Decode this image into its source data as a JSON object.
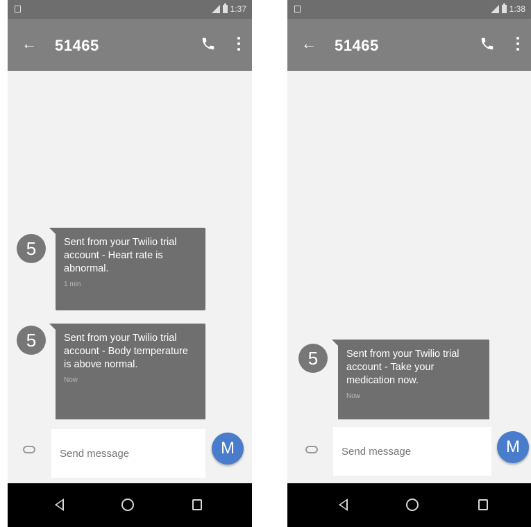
{
  "screens": [
    {
      "status": {
        "time": "1:37"
      },
      "header": {
        "title": "51465"
      },
      "messages": [
        {
          "avatar": "5",
          "text": "Sent from your Twilio trial account - Heart rate is abnormal.",
          "time": "1 min"
        },
        {
          "avatar": "5",
          "text": "Sent from your Twilio trial account - Body temperature is above normal.",
          "time": "Now"
        }
      ],
      "input": {
        "placeholder": "Send message",
        "fab_label": "M"
      }
    },
    {
      "status": {
        "time": "1:38"
      },
      "header": {
        "title": "51465"
      },
      "messages": [
        {
          "avatar": "5",
          "text": "Sent from your Twilio trial account - Take your medication now.",
          "time": "Now"
        }
      ],
      "input": {
        "placeholder": "Send message",
        "fab_label": "M"
      }
    }
  ],
  "colors": {
    "app_bar": "#808080",
    "status_bar": "#6e6e6e",
    "bubble": "#6f6f6f",
    "fab": "#4a7ccc",
    "nav_bar": "#000000"
  },
  "icons": [
    "sim-icon",
    "signal-icon",
    "battery-icon",
    "back-arrow-icon",
    "phone-icon",
    "more-icon",
    "attach-icon",
    "nav-back-icon",
    "nav-home-icon",
    "nav-recents-icon"
  ]
}
